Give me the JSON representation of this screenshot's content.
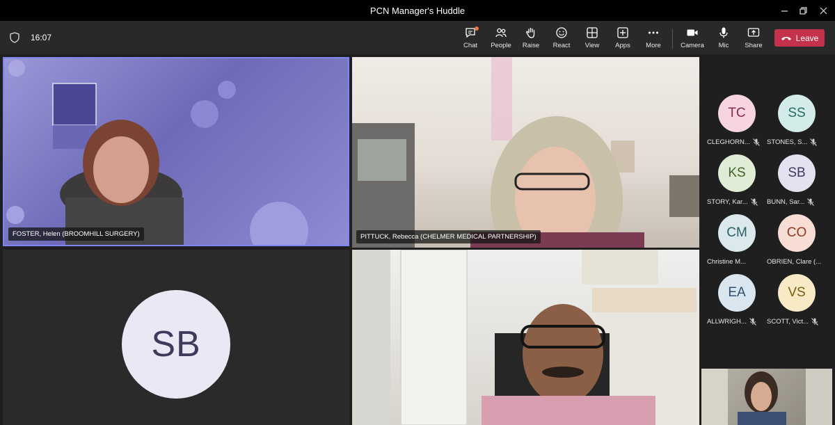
{
  "window": {
    "title": "PCN Manager's Huddle"
  },
  "toolbar": {
    "timer": "16:07",
    "buttons": [
      {
        "label": "Chat",
        "icon": "chat-icon"
      },
      {
        "label": "People",
        "icon": "people-icon"
      },
      {
        "label": "Raise",
        "icon": "raise-hand-icon"
      },
      {
        "label": "React",
        "icon": "react-icon"
      },
      {
        "label": "View",
        "icon": "view-icon"
      },
      {
        "label": "Apps",
        "icon": "apps-icon"
      },
      {
        "label": "More",
        "icon": "more-icon"
      },
      {
        "label": "Camera",
        "icon": "camera-icon"
      },
      {
        "label": "Mic",
        "icon": "mic-icon"
      },
      {
        "label": "Share",
        "icon": "share-icon"
      }
    ],
    "leave_label": "Leave"
  },
  "stage": {
    "tiles": [
      {
        "name": "FOSTER, Helen (BROOMHILL SURGERY)"
      },
      {
        "name": "PITTUCK, Rebecca (CHELMER MEDICAL PARTNERSHIP)"
      },
      {
        "initials": "SB"
      },
      {
        "name": ""
      }
    ]
  },
  "gallery": {
    "participants": [
      {
        "initials": "TC",
        "name": "CLEGHORN...",
        "bg": "#f6d5de",
        "fg": "#8a2a48"
      },
      {
        "initials": "SS",
        "name": "STONES, S...",
        "bg": "#d3ece9",
        "fg": "#236b64"
      },
      {
        "initials": "KS",
        "name": "STORY, Kar...",
        "bg": "#e0ecd6",
        "fg": "#41602b"
      },
      {
        "initials": "SB",
        "name": "BUNN, Sar...",
        "bg": "#e3e2f1",
        "fg": "#3d3a5c"
      },
      {
        "initials": "CM",
        "name": "Christine M...",
        "bg": "#dbe9ec",
        "fg": "#2b5d66"
      },
      {
        "initials": "CO",
        "name": "OBRIEN, Clare (...",
        "bg": "#f8ddd5",
        "fg": "#8c3a1f"
      },
      {
        "initials": "EA",
        "name": "ALLWRIGH...",
        "bg": "#d9e5ef",
        "fg": "#2d4e6b"
      },
      {
        "initials": "VS",
        "name": "SCOTT, Vict...",
        "bg": "#f7eac5",
        "fg": "#7a5c12"
      }
    ]
  },
  "colors": {
    "accent": "#7f85f5",
    "leave": "#c4314b",
    "toolbar": "#292929"
  }
}
